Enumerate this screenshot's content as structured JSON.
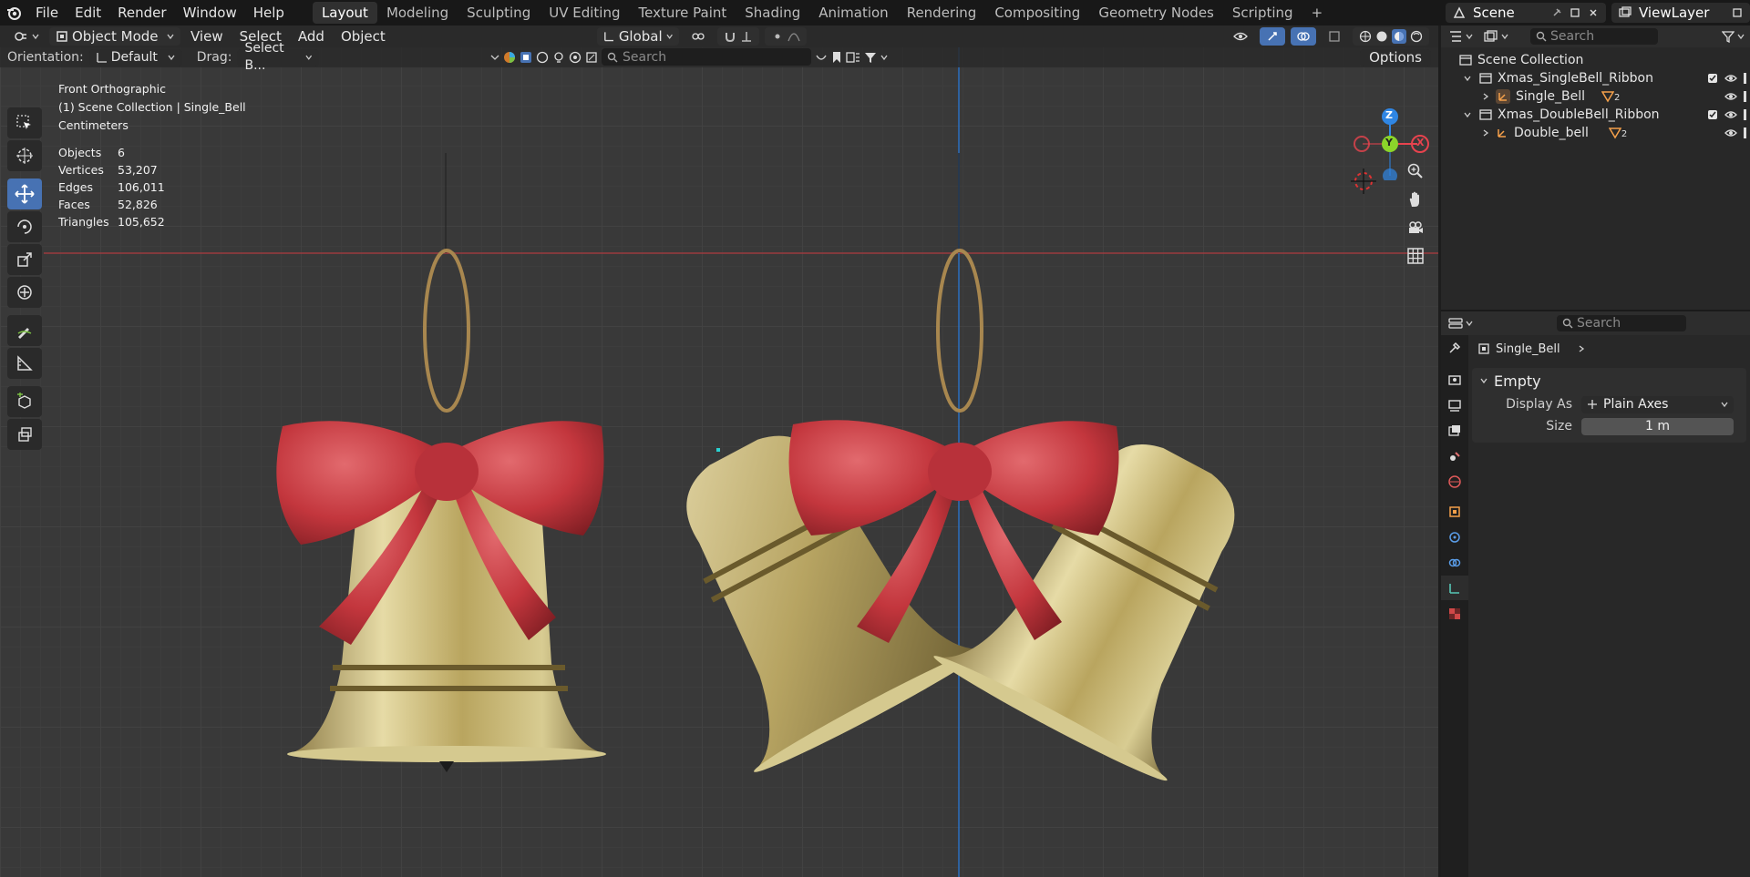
{
  "menu": {
    "items": [
      "File",
      "Edit",
      "Render",
      "Window",
      "Help"
    ]
  },
  "workspaces": {
    "tabs": [
      "Layout",
      "Modeling",
      "Sculpting",
      "UV Editing",
      "Texture Paint",
      "Shading",
      "Animation",
      "Rendering",
      "Compositing",
      "Geometry Nodes",
      "Scripting"
    ],
    "active": "Layout",
    "add_label": "+"
  },
  "topright": {
    "scene": "Scene",
    "view_layer": "ViewLayer"
  },
  "viewport_header": {
    "mode": "Object Mode",
    "menus": [
      "View",
      "Select",
      "Add",
      "Object"
    ],
    "transform_orientation": "Global"
  },
  "tool_settings": {
    "orientation_label": "Orientation:",
    "orientation_value": "Default",
    "drag_label": "Drag:",
    "drag_value": "Select B...",
    "search_placeholder": "Search",
    "options_label": "Options"
  },
  "overlay_info": {
    "view_name": "Front Orthographic",
    "collection": "(1) Scene Collection | Single_Bell",
    "units": "Centimeters",
    "stats": [
      {
        "label": "Objects",
        "value": "6"
      },
      {
        "label": "Vertices",
        "value": "53,207"
      },
      {
        "label": "Edges",
        "value": "106,011"
      },
      {
        "label": "Faces",
        "value": "52,826"
      },
      {
        "label": "Triangles",
        "value": "105,652"
      }
    ]
  },
  "gizmo": {
    "z": "Z",
    "y": "Y",
    "x": "X"
  },
  "outliner": {
    "search_placeholder": "Search",
    "root": "Scene Collection",
    "items": [
      {
        "name": "Xmas_SingleBell_Ribbon",
        "type": "collection"
      },
      {
        "name": "Single_Bell",
        "type": "empty",
        "badge": "2"
      },
      {
        "name": "Xmas_DoubleBell_Ribbon",
        "type": "collection"
      },
      {
        "name": "Double_bell",
        "type": "empty",
        "badge": "2"
      }
    ]
  },
  "properties": {
    "search_placeholder": "Search",
    "object_name": "Single_Bell",
    "panel_title": "Empty",
    "display_as_label": "Display As",
    "display_as_value": "Plain Axes",
    "size_label": "Size",
    "size_value": "1 m"
  },
  "colors": {
    "accent": "#4772b3",
    "x_axis": "#e8434e",
    "y_axis": "#8bd52a",
    "z_axis": "#2f86e4",
    "bell_gold": "#c9b77a",
    "ribbon_red": "#c0353c"
  }
}
